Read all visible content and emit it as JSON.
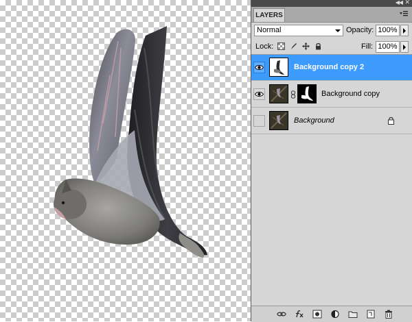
{
  "panel": {
    "tab_label": "LAYERS",
    "blend_mode": "Normal",
    "opacity_label": "Opacity:",
    "opacity_value": "100%",
    "lock_label": "Lock:",
    "fill_label": "Fill:",
    "fill_value": "100%"
  },
  "layers": [
    {
      "name": "Background copy 2",
      "visible": true,
      "selected": true,
      "has_mask": false,
      "locked": false
    },
    {
      "name": "Background copy",
      "visible": true,
      "selected": false,
      "has_mask": true,
      "locked": false
    },
    {
      "name": "Background",
      "visible": false,
      "selected": false,
      "has_mask": false,
      "locked": true
    }
  ],
  "footer_icons": [
    "link-layers-icon",
    "fx-icon",
    "add-mask-icon",
    "adjustment-layer-icon",
    "new-group-icon",
    "new-layer-icon",
    "trash-icon"
  ],
  "colors": {
    "selection": "#3d9bfe",
    "panel_bg": "#d6d6d6",
    "dock_bar": "#4a4a4a"
  }
}
